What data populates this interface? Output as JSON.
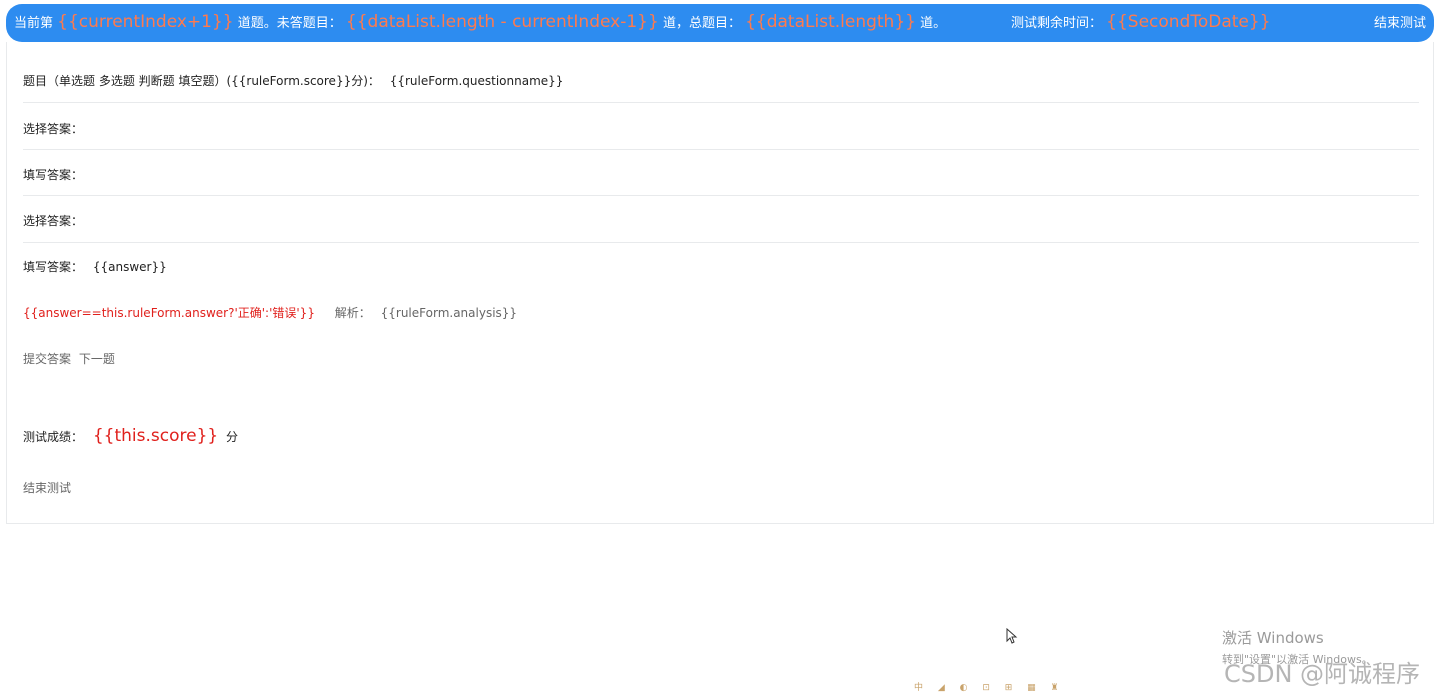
{
  "header": {
    "prefix": "当前第",
    "current_index": "{{currentIndex+1}}",
    "mid1": "道题。未答题目：",
    "remaining": "{{dataList.length - currentIndex-1}}",
    "mid2": "道，总题目：",
    "total": "{{dataList.length}}",
    "suffix": "道。",
    "timer_label": "测试剩余时间：",
    "timer_value": "{{SecondToDate}}",
    "end_button": "结束测试"
  },
  "question": {
    "prefix": "题目（单选题 多选题 判断题 填空题）({{ruleForm.score}}分)：",
    "name": "{{ruleForm.questionname}}"
  },
  "answers": [
    {
      "label": "选择答案：",
      "value": ""
    },
    {
      "label": "填写答案：",
      "value": ""
    },
    {
      "label": "选择答案：",
      "value": ""
    },
    {
      "label": "填写答案：",
      "value": "{{answer}}"
    }
  ],
  "result": {
    "verdict": "{{answer==this.ruleForm.answer?'正确':'错误'}}",
    "analysis_label": "解析：",
    "analysis_value": "{{ruleForm.analysis}}"
  },
  "actions": {
    "submit": "提交答案",
    "next": "下一题"
  },
  "score": {
    "label": "测试成绩：",
    "value": "{{this.score}}",
    "unit": "分"
  },
  "end_link": "结束测试",
  "watermark": {
    "title": "激活 Windows",
    "subtitle": "转到\"设置\"以激活 Windows。",
    "csdn": "CSDN @阿诚程序"
  },
  "taskbar_icons": "中 ◢ ◐ ⊡ ⊞ ▦ ♜ ⚙"
}
